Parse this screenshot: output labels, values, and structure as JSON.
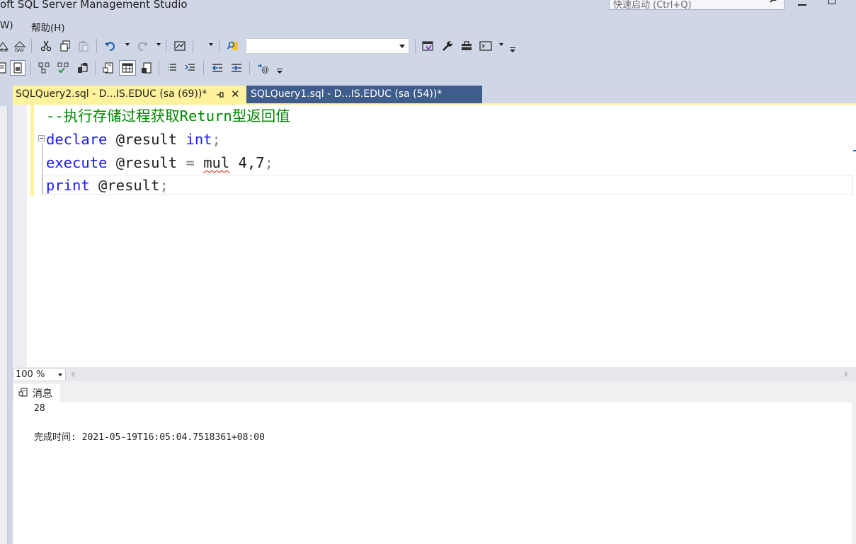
{
  "window": {
    "title": "oft SQL Server Management Studio",
    "quick_launch_placeholder": "快速启动 (Ctrl+Q)"
  },
  "menu": {
    "items": [
      "W)",
      "帮助(H)"
    ]
  },
  "toolbar1": {
    "database_combo_value": ""
  },
  "tabs": [
    {
      "label": "SQLQuery2.sql - D...IS.EDUC (sa (69))*",
      "active": true,
      "pin_glyph": "⊣",
      "close_glyph": "✕"
    },
    {
      "label": "SQLQuery1.sql - D...IS.EDUC (sa (54))*",
      "active": false
    }
  ],
  "editor": {
    "lines": [
      {
        "comment": "--执行存储过程获取Return型返回值"
      },
      {
        "kw1": "declare",
        "var": " @result ",
        "kw2": "int",
        "punct": ";"
      },
      {
        "kw1": "execute",
        "var": " @result ",
        "op": "=",
        "sp": " ",
        "proc": "mul",
        "args": " 4,7",
        "punct": ";"
      },
      {
        "kw1": "print",
        "var": " @result",
        "punct": ";"
      }
    ]
  },
  "zoom": {
    "value": "100 %"
  },
  "results": {
    "tab_label": "消息",
    "messages": [
      "28",
      "完成时间: 2021-05-19T16:05:04.7518361+08:00"
    ]
  },
  "icons": {
    "toolbar1": [
      "mdx-query-icon",
      "dax-query-icon",
      "cut-icon",
      "copy-icon",
      "paste-icon",
      "undo-icon",
      "redo-icon",
      "solution-explorer-icon",
      "find-icon",
      "vs-icon",
      "wrench-icon",
      "toolbox-icon",
      "output-window-icon"
    ],
    "toolbar2": [
      "results-to-text-icon",
      "results-to-grid-icon",
      "display-plan-icon",
      "include-plan-icon",
      "statistics-icon",
      "results-to-file-icon",
      "comment-icon",
      "uncomment-icon",
      "decrease-indent-icon",
      "increase-indent-icon",
      "specify-values-icon"
    ]
  },
  "colors": {
    "active_tab": "#fff29d",
    "inactive_tab": "#3f5d8c",
    "keyword": "#1a1aff",
    "comment": "#008a00",
    "chrome": "#cfd6e5"
  }
}
